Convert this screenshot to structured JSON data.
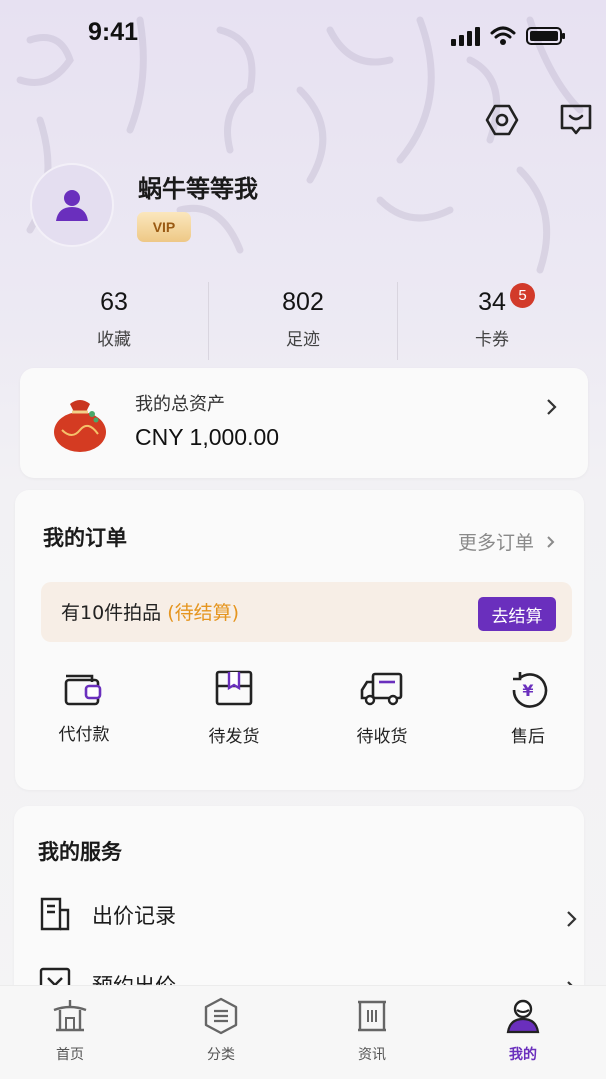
{
  "status_bar": {
    "time": "9:41"
  },
  "profile": {
    "username": "蜗牛等等我",
    "badge": "VIP"
  },
  "stats": [
    {
      "value": "63",
      "label": "收藏"
    },
    {
      "value": "802",
      "label": "足迹"
    },
    {
      "value": "34",
      "label": "卡券",
      "badge": "5"
    }
  ],
  "assets": {
    "title": "我的总资产",
    "amount": "CNY 1,000.00"
  },
  "orders": {
    "title": "我的订单",
    "more": "更多订单",
    "pending_prefix": "有10件拍品",
    "pending_status": "(待结算)",
    "settle_button": "去结算",
    "items": [
      {
        "label": "代付款",
        "icon": "wallet-icon"
      },
      {
        "label": "待发货",
        "icon": "box-icon"
      },
      {
        "label": "待收货",
        "icon": "truck-icon"
      },
      {
        "label": "售后",
        "icon": "refund-icon"
      }
    ]
  },
  "services": {
    "title": "我的服务",
    "items": [
      {
        "label": "出价记录",
        "icon": "bid-record-icon"
      },
      {
        "label": "预约出价",
        "icon": "reserve-bid-icon"
      }
    ]
  },
  "tabbar": [
    {
      "label": "首页",
      "icon": "home-pavilion-icon"
    },
    {
      "label": "分类",
      "icon": "category-icon"
    },
    {
      "label": "资讯",
      "icon": "news-icon"
    },
    {
      "label": "我的",
      "icon": "profile-icon",
      "active": true
    }
  ],
  "colors": {
    "accent": "#6a2fbd",
    "highlight": "#e5951f",
    "badge": "#d23a2a",
    "vip_text": "#9a5a13"
  }
}
